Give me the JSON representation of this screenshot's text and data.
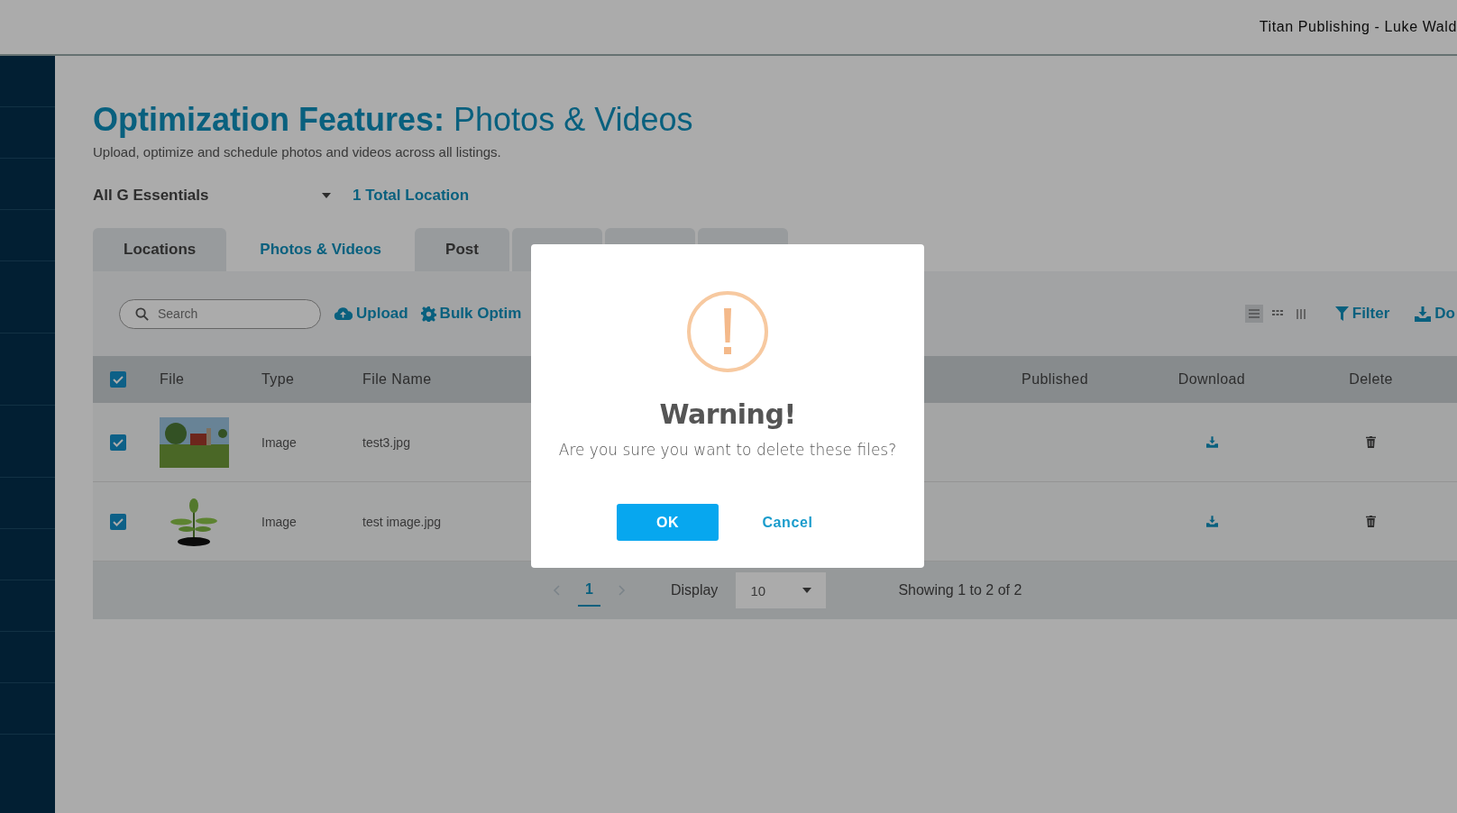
{
  "header": {
    "account": "Titan Publishing - Luke Wald"
  },
  "page": {
    "title_bold": "Optimization Features:",
    "title_light": "Photos & Videos",
    "subtitle": "Upload, optimize and schedule photos and videos across all listings."
  },
  "group_select": {
    "value": "All G Essentials"
  },
  "location_count": "1 Total Location",
  "tabs": [
    {
      "label": "Locations",
      "selected": false
    },
    {
      "label": "Photos & Videos",
      "selected": true
    },
    {
      "label": "Post",
      "selected": false
    },
    {
      "selected": false
    },
    {
      "selected": false
    },
    {
      "selected": false
    }
  ],
  "toolbar": {
    "search_placeholder": "Search",
    "upload": "Upload",
    "bulk": "Bulk Optim",
    "filter": "Filter",
    "download": "Do",
    "view_modes": [
      {
        "kind": "list",
        "selected": true
      },
      {
        "kind": "grid",
        "selected": false
      },
      {
        "kind": "columns",
        "selected": false
      }
    ]
  },
  "table": {
    "select_all": {
      "checked": true
    },
    "columns": [
      "File",
      "Type",
      "File Name",
      "Published",
      "Download",
      "Delete"
    ],
    "rows": [
      {
        "checked": true,
        "kind": "field",
        "type": "Image",
        "file_name": "test3.jpg"
      },
      {
        "checked": true,
        "kind": "plant",
        "type": "Image",
        "file_name": "test image.jpg"
      }
    ]
  },
  "pagination": {
    "page": "1",
    "display_label": "Display",
    "page_size": "10",
    "summary": "Showing 1 to 2 of 2"
  },
  "dialog": {
    "title": "Warning!",
    "message": "Are you sure you want to delete these files?",
    "ok": "OK",
    "cancel": "Cancel"
  }
}
